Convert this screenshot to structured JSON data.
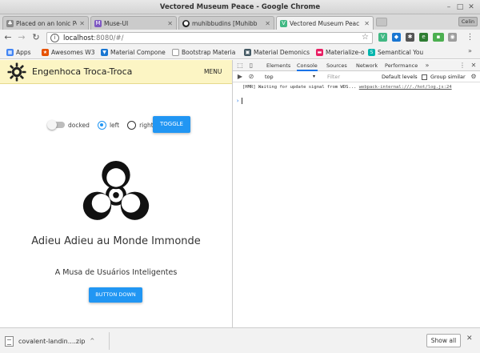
{
  "window": {
    "title": "Vectored Museum Peace - Google Chrome"
  },
  "tabs": [
    {
      "label": "Placed on an Ionic Pe",
      "icon": "tree-icon",
      "color": "#555555"
    },
    {
      "label": "Muse-UI",
      "icon": "muse-icon",
      "color": "#7e57c2"
    },
    {
      "label": "muhibbudins [Muhibb",
      "icon": "github-icon",
      "color": "#222222"
    },
    {
      "label": "Vectored Museum Peac",
      "icon": "vue-icon",
      "color": "#41b883"
    }
  ],
  "profile": "Celin",
  "omnibox": {
    "host": "localhost",
    "rest": ":8080/#/"
  },
  "bookmarks": [
    {
      "label": "Apps",
      "icon": "apps-grid-icon",
      "color": "#4285f4"
    },
    {
      "label": "Awesomes W3",
      "icon": "bookmark-icon",
      "color": "#e65100"
    },
    {
      "label": "Material Compone",
      "icon": "material-icon",
      "color": "#1976d2"
    },
    {
      "label": "Bootstrap Materia",
      "icon": "page-icon",
      "color": "#9e9e9e"
    },
    {
      "label": "Material Demonics",
      "icon": "material-icon",
      "color": "#455a64"
    },
    {
      "label": "Materialize-o",
      "icon": "materialize-icon",
      "color": "#e91e63"
    },
    {
      "label": "Semantical You",
      "icon": "semantic-icon",
      "color": "#00b5ad"
    }
  ],
  "app": {
    "title": "Engenhoca Troca-Troca",
    "menu_label": "MENU",
    "docked_label": "docked",
    "left_label": "left",
    "right_label": "right",
    "toggle_label": "TOGGLE",
    "headline": "Adieu Adieu au Monde Immonde",
    "subline": "A Musa de Usuários Inteligentes",
    "button_down_label": "BUTTON DOWN"
  },
  "devtools": {
    "tabs": [
      "Elements",
      "Console",
      "Sources",
      "Network",
      "Performance"
    ],
    "active_tab": "Console",
    "context": "top",
    "filter_placeholder": "Filter",
    "levels": "Default levels",
    "group_similar": "Group similar",
    "message": "[HMR] Waiting for update signal from WDS...",
    "message_source": "webpack-internal:///./hot/log.js:24"
  },
  "downloads": {
    "file": "covalent-landin....zip",
    "show_all_label": "Show all"
  }
}
